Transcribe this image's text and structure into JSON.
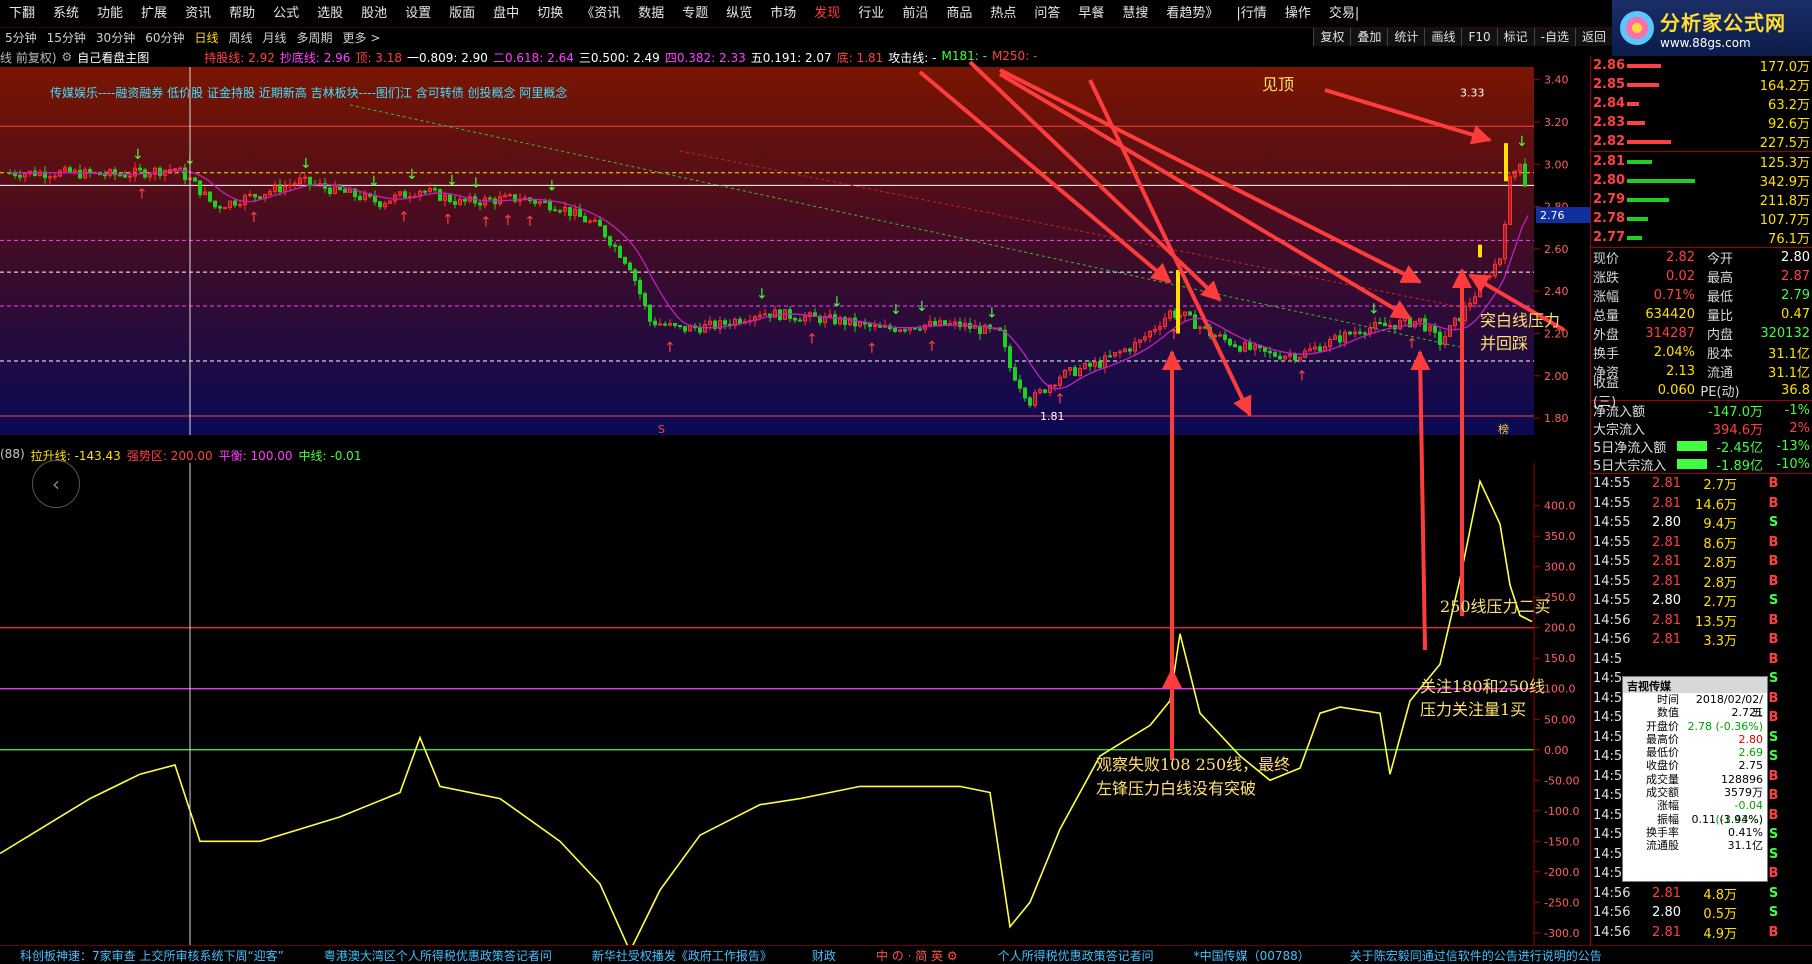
{
  "menu": [
    "下翻",
    "系统",
    "功能",
    "扩展",
    "资讯",
    "帮助",
    "公式",
    "选股",
    "股池",
    "设置",
    "版面",
    "盘中",
    "切换",
    "《资讯",
    "数据",
    "专题",
    "纵览",
    "市场",
    "发现",
    "行业",
    "前沿",
    "商品",
    "热点",
    "问答",
    "早餐",
    "慧搜",
    "看趋势》",
    "|行情",
    "操作",
    "交易|"
  ],
  "menu_active": "发现",
  "logo": {
    "title": "分析家公式网",
    "url": "www.88gs.com"
  },
  "periods": [
    "5分钟",
    "15分钟",
    "30分钟",
    "60分钟",
    "日线",
    "周线",
    "月线",
    "多周期",
    "更多 >"
  ],
  "period_active": "日线",
  "right_tools": [
    "复权",
    "叠加",
    "统计",
    "画线",
    "F10",
    "标记",
    "-自选",
    "返回"
  ],
  "main_header": {
    "mode": "线 前复权)",
    "formula": "自己看盘主图",
    "items": [
      {
        "text": "持股线: 2.92",
        "color": "#ff4040"
      },
      {
        "text": "抄底线: 2.96",
        "color": "#ff40ff"
      },
      {
        "text": "顶: 3.18",
        "color": "#ff4040"
      },
      {
        "text": "一0.809: 2.90",
        "color": "#ffffff"
      },
      {
        "text": "二0.618: 2.64",
        "color": "#ff40ff"
      },
      {
        "text": "三0.500: 2.49",
        "color": "#ffffff"
      },
      {
        "text": "四0.382: 2.33",
        "color": "#ff40ff"
      },
      {
        "text": "五0.191: 2.07",
        "color": "#ffffff"
      },
      {
        "text": "底: 1.81",
        "color": "#ff4040"
      },
      {
        "text": "攻击线: -",
        "color": "#ffffff"
      },
      {
        "text": "M181: -",
        "color": "#40ff40"
      },
      {
        "text": "M250: -",
        "color": "#ff4040"
      }
    ]
  },
  "concepts": "传媒娱乐----融资融券 低价股 证金持股 近期新高 吉林板块----图们江 含可转债 创投概念 阿里概念",
  "main_axis_ticks": [
    "3.40",
    "3.20",
    "3.00",
    "2.80",
    "2.60",
    "2.40",
    "2.20",
    "2.00",
    "1.80"
  ],
  "price_marker": "2.76",
  "hi_label": "3.33",
  "lo_label": "1.81",
  "sub_header": [
    {
      "text": "(88)",
      "color": "#c8c8c8"
    },
    {
      "text": "拉升线: -143.43",
      "color": "#ffe000"
    },
    {
      "text": "强势区: 200.00",
      "color": "#ff4040"
    },
    {
      "text": "平衡: 100.00",
      "color": "#ff40ff"
    },
    {
      "text": "中线: -0.01",
      "color": "#40ff40"
    }
  ],
  "sub_axis_ticks": [
    "400.0",
    "350.0",
    "300.0",
    "250.0",
    "200.0",
    "150.0",
    "100.0",
    "50.00",
    "0.00",
    "-50.00",
    "-100.0",
    "-150.0",
    "-200.0",
    "-250.0",
    "-300.0"
  ],
  "annotations": {
    "top": "见顶",
    "break_white_1": "突白线压力",
    "break_white_2": "并回踩",
    "line250": "250线压力二买",
    "watch1": "关注180和250线",
    "watch2": "压力关注量1买",
    "fail1": "观察失败108 250线，最终",
    "fail2": "左锋压力白线没有突破"
  },
  "chart_markers": {
    "s_mark": "S",
    "yu_mark": "榜"
  },
  "order_book": {
    "asks": [
      {
        "price": "2.86",
        "vol": "177.0万",
        "bar": 0.28
      },
      {
        "price": "2.85",
        "vol": "164.2万",
        "bar": 0.26
      },
      {
        "price": "2.84",
        "vol": "63.2万",
        "bar": 0.1
      },
      {
        "price": "2.83",
        "vol": "92.6万",
        "bar": 0.15
      },
      {
        "price": "2.82",
        "vol": "227.5万",
        "bar": 0.36
      }
    ],
    "bids": [
      {
        "price": "2.81",
        "vol": "125.3万",
        "bar": 0.2
      },
      {
        "price": "2.80",
        "vol": "342.9万",
        "bar": 0.55
      },
      {
        "price": "2.79",
        "vol": "211.8万",
        "bar": 0.34
      },
      {
        "price": "2.78",
        "vol": "107.7万",
        "bar": 0.17
      },
      {
        "price": "2.77",
        "vol": "76.1万",
        "bar": 0.12
      }
    ]
  },
  "stats": [
    {
      "k": "现价",
      "v": "2.82",
      "vc": "#ff4040",
      "k2": "今开",
      "v2": "2.80",
      "v2c": "#ffffff"
    },
    {
      "k": "涨跌",
      "v": "0.02",
      "vc": "#ff4040",
      "k2": "最高",
      "v2": "2.87",
      "v2c": "#ff4040"
    },
    {
      "k": "涨幅",
      "v": "0.71%",
      "vc": "#ff4040",
      "k2": "最低",
      "v2": "2.79",
      "v2c": "#40ff40"
    },
    {
      "k": "总量",
      "v": "634420",
      "vc": "#ffe000",
      "k2": "量比",
      "v2": "0.47",
      "v2c": "#ffe000"
    },
    {
      "k": "外盘",
      "v": "314287",
      "vc": "#ff4040",
      "k2": "内盘",
      "v2": "320132",
      "v2c": "#40ff40"
    },
    {
      "k": "换手",
      "v": "2.04%",
      "vc": "#ffe000",
      "k2": "股本",
      "v2": "31.1亿",
      "v2c": "#ffe000"
    },
    {
      "k": "净资",
      "v": "2.13",
      "vc": "#ffe000",
      "k2": "流通",
      "v2": "31.1亿",
      "v2c": "#ffe000"
    },
    {
      "k": "收益(三)",
      "v": "0.060",
      "vc": "#ffe000",
      "k2": "PE(动)",
      "v2": "36.8",
      "v2c": "#ffe000"
    }
  ],
  "flows": [
    {
      "k": "净流入额",
      "v": "-147.0万",
      "vc": "#40ff40",
      "p": "-1%",
      "pc": "#40ff40",
      "flag": "#000000"
    },
    {
      "k": "大宗流入",
      "v": "394.6万",
      "vc": "#ff4040",
      "p": "2%",
      "pc": "#ff4040",
      "flag": "#000000"
    },
    {
      "k": "5日净流入额",
      "v": "-2.45亿",
      "vc": "#40ff40",
      "p": "-13%",
      "pc": "#40ff40",
      "flag": "#40ff40"
    },
    {
      "k": "5日大宗流入",
      "v": "-1.89亿",
      "vc": "#40ff40",
      "p": "-10%",
      "pc": "#40ff40",
      "flag": "#40ff40"
    }
  ],
  "ticks": [
    {
      "t": "14:55",
      "p": "2.81",
      "pc": "#ff4040",
      "v": "2.7万",
      "bs": "B",
      "bsc": "#ff4040"
    },
    {
      "t": "14:55",
      "p": "2.81",
      "pc": "#ff4040",
      "v": "14.6万",
      "bs": "B",
      "bsc": "#ff4040"
    },
    {
      "t": "14:55",
      "p": "2.80",
      "pc": "#ffffff",
      "v": "9.4万",
      "bs": "S",
      "bsc": "#40ff40"
    },
    {
      "t": "14:55",
      "p": "2.81",
      "pc": "#ff4040",
      "v": "8.6万",
      "bs": "B",
      "bsc": "#ff4040"
    },
    {
      "t": "14:55",
      "p": "2.81",
      "pc": "#ff4040",
      "v": "2.8万",
      "bs": "B",
      "bsc": "#ff4040"
    },
    {
      "t": "14:55",
      "p": "2.81",
      "pc": "#ff4040",
      "v": "2.8万",
      "bs": "B",
      "bsc": "#ff4040"
    },
    {
      "t": "14:55",
      "p": "2.80",
      "pc": "#ffffff",
      "v": "2.7万",
      "bs": "S",
      "bsc": "#40ff40"
    },
    {
      "t": "14:56",
      "p": "2.81",
      "pc": "#ff4040",
      "v": "13.5万",
      "bs": "B",
      "bsc": "#ff4040"
    },
    {
      "t": "14:56",
      "p": "2.81",
      "pc": "#ff4040",
      "v": "3.3万",
      "bs": "B",
      "bsc": "#ff4040"
    },
    {
      "t": "14:5",
      "p": "",
      "pc": "#ff4040",
      "v": "",
      "bs": "B",
      "bsc": "#ff4040"
    },
    {
      "t": "14:5",
      "p": "",
      "pc": "#ff4040",
      "v": "",
      "bs": "S",
      "bsc": "#40ff40"
    },
    {
      "t": "14:5",
      "p": "",
      "pc": "#ff4040",
      "v": "",
      "bs": "B",
      "bsc": "#ff4040"
    },
    {
      "t": "14:5",
      "p": "",
      "pc": "#ff4040",
      "v": "",
      "bs": "B",
      "bsc": "#ff4040"
    },
    {
      "t": "14:5",
      "p": "",
      "pc": "#ff4040",
      "v": "",
      "bs": "S",
      "bsc": "#40ff40"
    },
    {
      "t": "14:5",
      "p": "",
      "pc": "#ff4040",
      "v": "",
      "bs": "S",
      "bsc": "#40ff40"
    },
    {
      "t": "14:5",
      "p": "",
      "pc": "#ff4040",
      "v": "",
      "bs": "B",
      "bsc": "#ff4040"
    },
    {
      "t": "14:5",
      "p": "",
      "pc": "#ff4040",
      "v": "",
      "bs": "B",
      "bsc": "#ff4040"
    },
    {
      "t": "14:5",
      "p": "",
      "pc": "#ff4040",
      "v": "",
      "bs": "B",
      "bsc": "#ff4040"
    },
    {
      "t": "14:5",
      "p": "",
      "pc": "#ff4040",
      "v": "",
      "bs": "S",
      "bsc": "#40ff40"
    },
    {
      "t": "14:5",
      "p": "",
      "pc": "#ff4040",
      "v": "",
      "bs": "S",
      "bsc": "#40ff40"
    },
    {
      "t": "14:5",
      "p": "",
      "pc": "#ff4040",
      "v": "",
      "bs": "B",
      "bsc": "#ff4040"
    },
    {
      "t": "14:56",
      "p": "2.81",
      "pc": "#ff4040",
      "v": "4.8万",
      "bs": "S",
      "bsc": "#40ff40"
    },
    {
      "t": "14:56",
      "p": "2.80",
      "pc": "#ffffff",
      "v": "0.5万",
      "bs": "S",
      "bsc": "#40ff40"
    },
    {
      "t": "14:56",
      "p": "2.81",
      "pc": "#ff4040",
      "v": "4.9万",
      "bs": "B",
      "bsc": "#ff4040"
    }
  ],
  "popup": {
    "title": "吉视传媒",
    "rows": [
      {
        "k": "时间",
        "v": "2018/02/02/五"
      },
      {
        "k": "数值",
        "v": "2.721"
      },
      {
        "k": "开盘价",
        "v": "2.78 (-0.36%)"
      },
      {
        "k": "最高价",
        "v": "2.80"
      },
      {
        "k": "最低价",
        "v": "2.69"
      },
      {
        "k": "收盘价",
        "v": "2.75"
      },
      {
        "k": "成交量",
        "v": "128896"
      },
      {
        "k": "成交额",
        "v": "3579万"
      },
      {
        "k": "涨幅",
        "v": "-0.04 (-1.43%)"
      },
      {
        "k": "振幅",
        "v": "0.11 (3.94%)"
      },
      {
        "k": "换手率",
        "v": "0.41%"
      },
      {
        "k": "流通股",
        "v": "31.1亿"
      }
    ]
  },
  "ticker": [
    "科创板神速：7家审查 上交所审核系统下周“迎客”",
    "粤港澳大湾区个人所得税优惠政策答记者问",
    "新华社受权播发《政府工作报告》",
    "财政",
    "中 の · 简 英 ⚙",
    "个人所得税优惠政策答记者问",
    "*中国传媒（00788）",
    "关于陈宏毅同通过信软件的公告进行说明的公告"
  ],
  "colors": {
    "up": "#ff3030",
    "down": "#20d020",
    "ma": "#c020c0",
    "indicator": "#ffff40",
    "arrow": "#ff3c3c"
  }
}
